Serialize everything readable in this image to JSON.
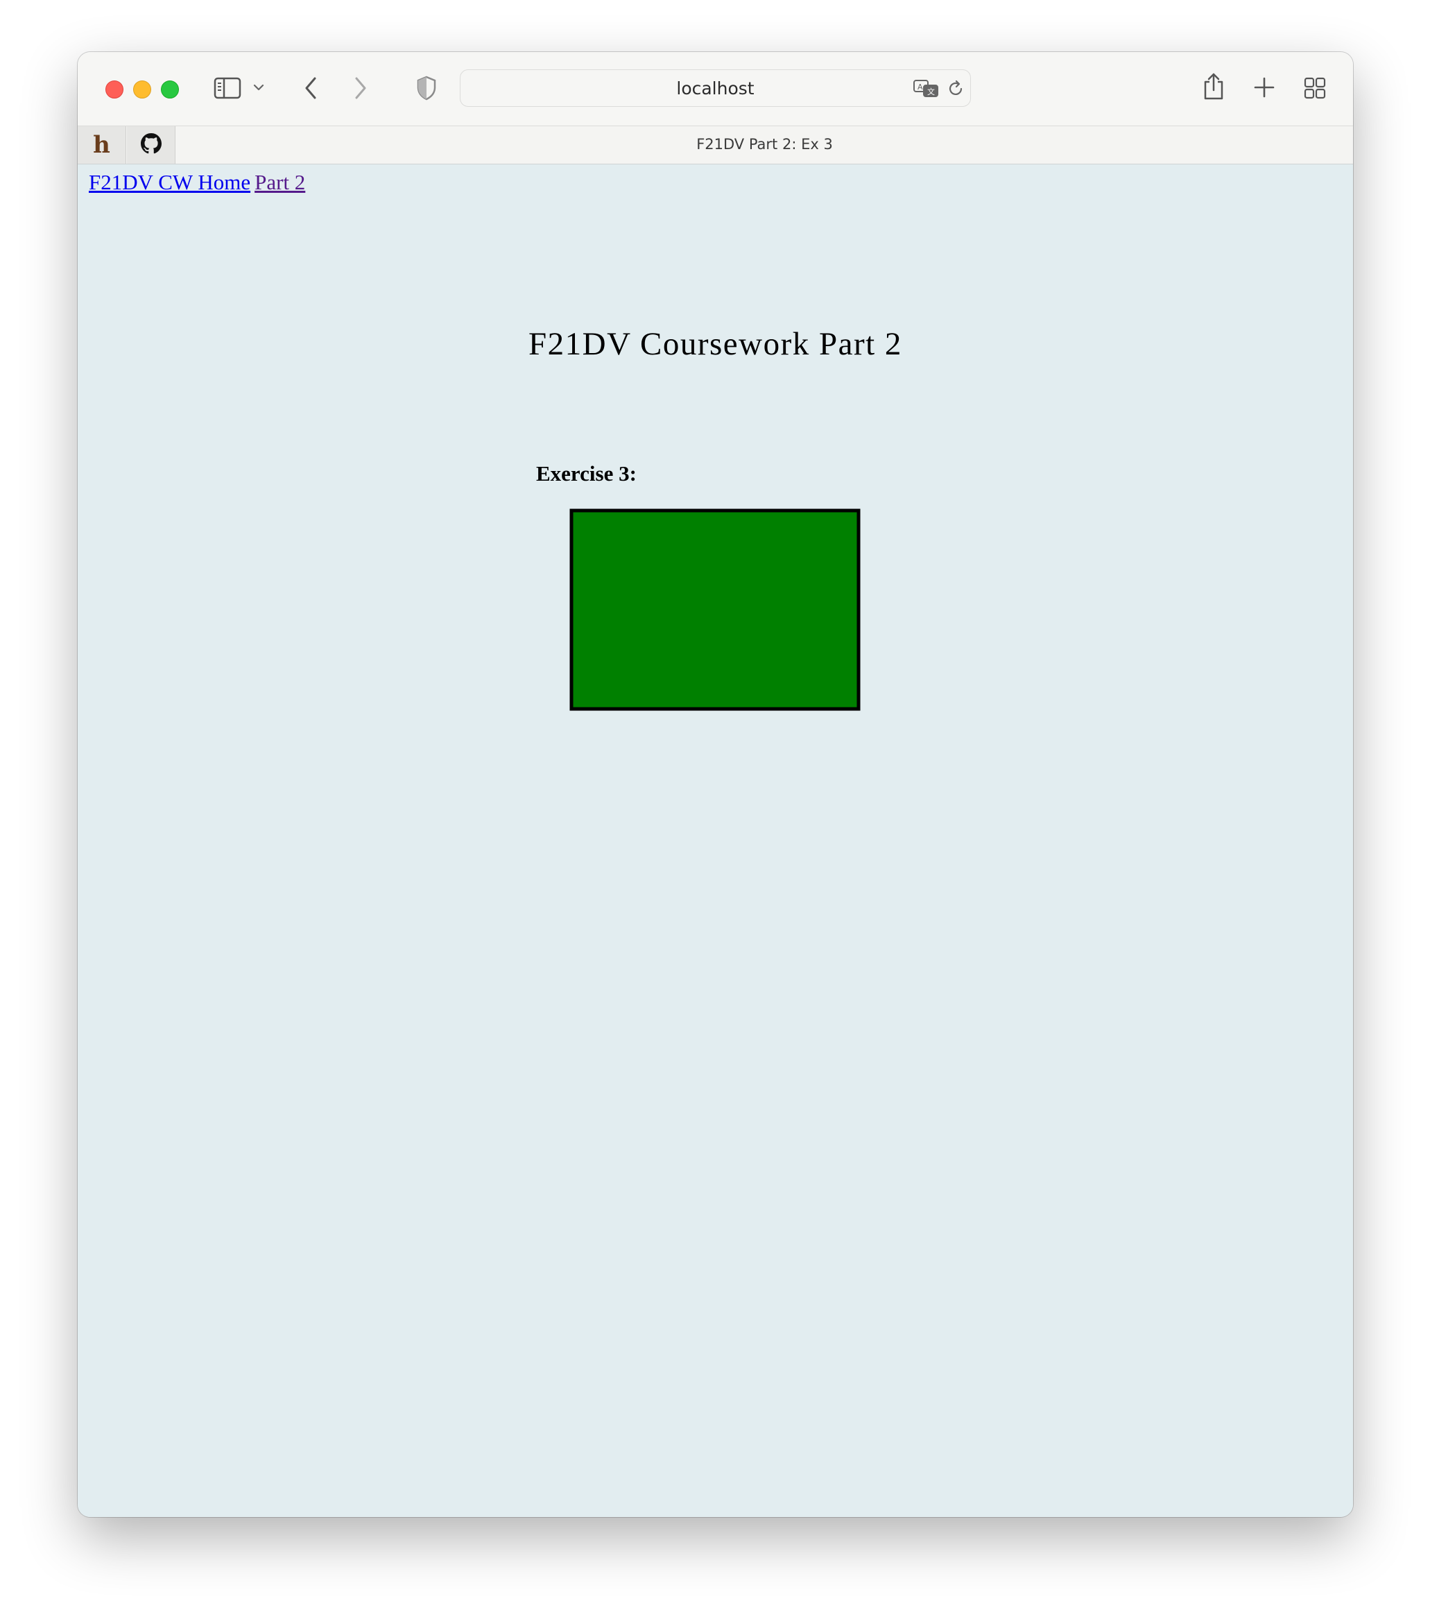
{
  "browser": {
    "address": "localhost",
    "tab_title": "F21DV Part 2: Ex 3"
  },
  "nav": {
    "home_label": "F21DV CW Home",
    "part_label": "Part 2"
  },
  "page": {
    "title": "F21DV Coursework Part 2",
    "exercise_label": "Exercise 3:",
    "rect_fill": "#008000",
    "rect_stroke": "#000000"
  },
  "colors": {
    "page_background": "#e2edf0",
    "link_unvisited": "#0000ee",
    "link_visited": "#551a8b"
  },
  "icons": [
    "sidebar-icon",
    "chevron-down-icon",
    "back-icon",
    "forward-icon",
    "shield-icon",
    "translate-icon",
    "reload-icon",
    "share-icon",
    "plus-icon",
    "tab-overview-icon",
    "h-logo-icon",
    "github-icon"
  ]
}
